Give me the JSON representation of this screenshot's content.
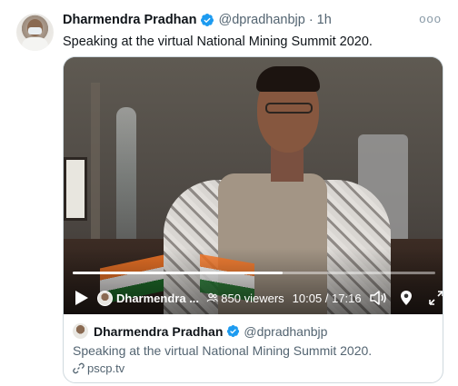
{
  "tweet": {
    "author_name": "Dharmendra Pradhan",
    "author_handle": "@dpradhanbjp",
    "separator": "·",
    "time": "1h",
    "more": "ooo",
    "text": "Speaking at the virtual National Mining Summit 2020."
  },
  "video": {
    "broadcaster": "Dharmendra ...",
    "viewers": "850 viewers",
    "time": "10:05 / 17:16",
    "progress": 0.58
  },
  "embed": {
    "author_name": "Dharmendra Pradhan",
    "author_handle": "@dpradhanbjp",
    "text": "Speaking at the virtual National Mining Summit 2020.",
    "link": "pscp.tv"
  },
  "colors": {
    "verified": "#1d9bf0",
    "secondary_text": "#536471",
    "border": "#cfd9de"
  },
  "icons": [
    "verified-badge-icon",
    "more-options-icon",
    "play-icon",
    "viewers-icon",
    "volume-icon",
    "location-icon",
    "fullscreen-icon",
    "link-icon"
  ]
}
